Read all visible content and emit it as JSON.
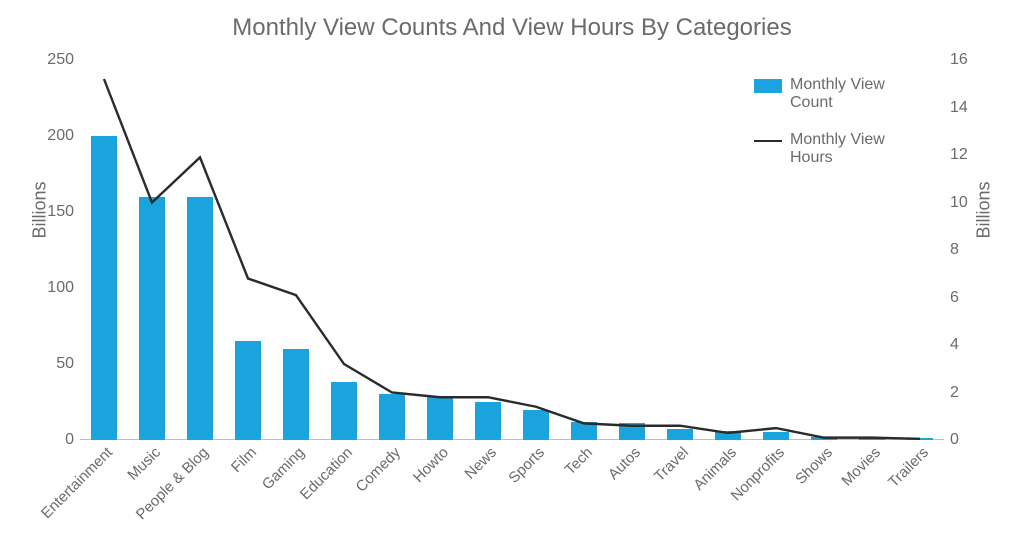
{
  "title": "Monthly View Counts And View Hours By Categories",
  "legend": {
    "count": "Monthly View Count",
    "hours": "Monthly View Hours"
  },
  "yleft_label": "Billions",
  "yright_label": "Billions",
  "colors": {
    "bar": "#1aa3dd",
    "line": "#2b2b2b"
  },
  "yleft": {
    "min": 0,
    "max": 250,
    "ticks": [
      0,
      50,
      100,
      150,
      200,
      250
    ]
  },
  "yright": {
    "min": 0,
    "max": 16,
    "ticks": [
      0,
      2,
      4,
      6,
      8,
      10,
      12,
      14,
      16
    ]
  },
  "chart_data": {
    "type": "bar+line",
    "categories": [
      "Entertainment",
      "Music",
      "People & Blog",
      "Film",
      "Gaming",
      "Education",
      "Comedy",
      "Howto",
      "News",
      "Sports",
      "Tech",
      "Autos",
      "Travel",
      "Animals",
      "Nonprofits",
      "Shows",
      "Movies",
      "Trailers"
    ],
    "series": [
      {
        "name": "Monthly View Count",
        "axis": "left",
        "style": "bar",
        "values": [
          200,
          160,
          160,
          65,
          60,
          38,
          30,
          28,
          25,
          20,
          12,
          11,
          7,
          6,
          5,
          2,
          1,
          1
        ]
      },
      {
        "name": "Monthly View Hours",
        "axis": "right",
        "style": "line",
        "values": [
          15.2,
          10.0,
          11.9,
          6.8,
          6.1,
          3.2,
          2.0,
          1.8,
          1.8,
          1.4,
          0.7,
          0.6,
          0.6,
          0.3,
          0.5,
          0.1,
          0.1,
          0.05
        ]
      }
    ],
    "title": "Monthly View Counts And View Hours By Categories",
    "xlabel": "",
    "yleft_label": "Billions",
    "yright_label": "Billions",
    "ylim_left": [
      0,
      250
    ],
    "ylim_right": [
      0,
      16
    ]
  }
}
